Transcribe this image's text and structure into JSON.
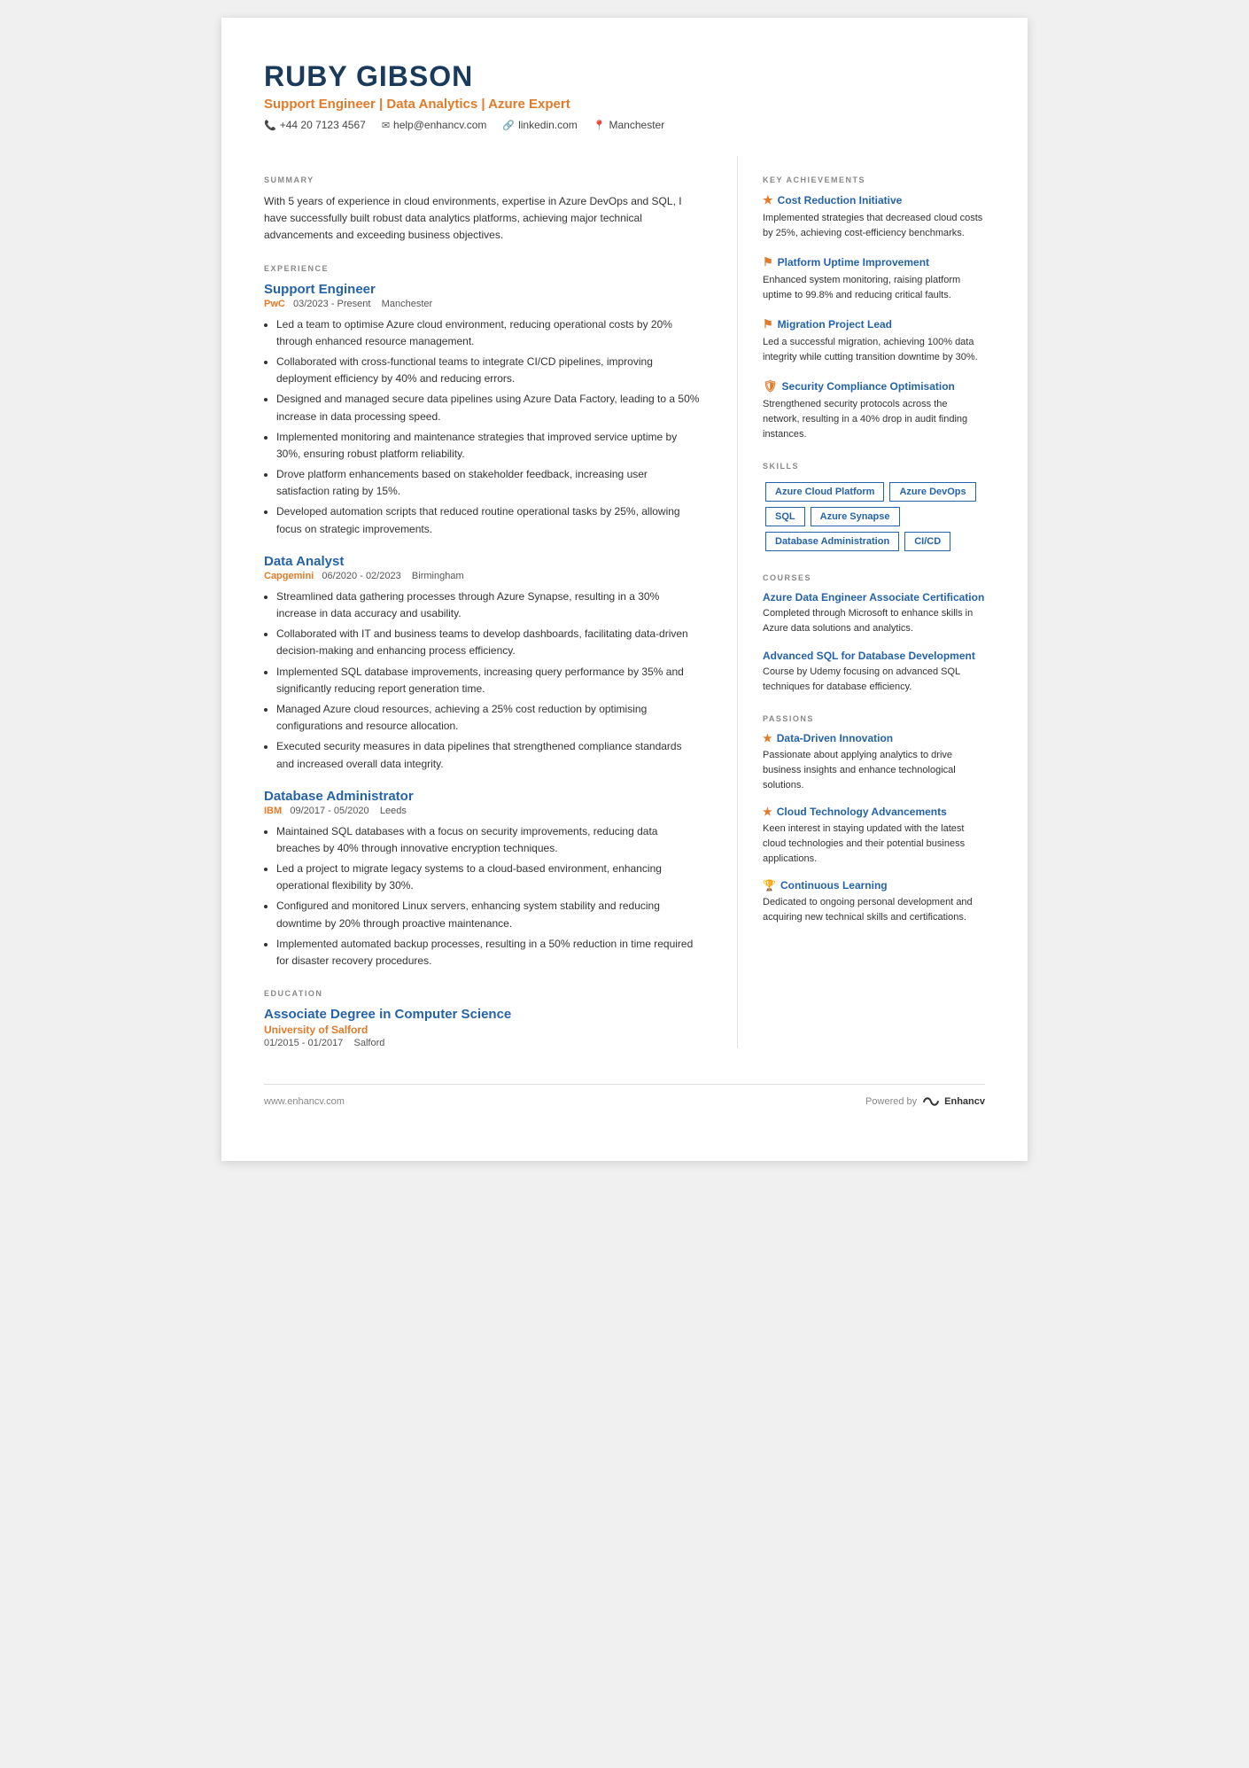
{
  "header": {
    "name": "RUBY GIBSON",
    "title": "Support Engineer | Data Analytics | Azure Expert",
    "phone": "+44 20 7123 4567",
    "email": "help@enhancv.com",
    "linkedin": "linkedin.com",
    "location": "Manchester"
  },
  "summary": {
    "label": "SUMMARY",
    "text": "With 5 years of experience in cloud environments, expertise in Azure DevOps and SQL, I have successfully built robust data analytics platforms, achieving major technical advancements and exceeding business objectives."
  },
  "experience": {
    "label": "EXPERIENCE",
    "jobs": [
      {
        "title": "Support Engineer",
        "company": "PwC",
        "dates": "03/2023 - Present",
        "location": "Manchester",
        "bullets": [
          "Led a team to optimise Azure cloud environment, reducing operational costs by 20% through enhanced resource management.",
          "Collaborated with cross-functional teams to integrate CI/CD pipelines, improving deployment efficiency by 40% and reducing errors.",
          "Designed and managed secure data pipelines using Azure Data Factory, leading to a 50% increase in data processing speed.",
          "Implemented monitoring and maintenance strategies that improved service uptime by 30%, ensuring robust platform reliability.",
          "Drove platform enhancements based on stakeholder feedback, increasing user satisfaction rating by 15%.",
          "Developed automation scripts that reduced routine operational tasks by 25%, allowing focus on strategic improvements."
        ]
      },
      {
        "title": "Data Analyst",
        "company": "Capgemini",
        "dates": "06/2020 - 02/2023",
        "location": "Birmingham",
        "bullets": [
          "Streamlined data gathering processes through Azure Synapse, resulting in a 30% increase in data accuracy and usability.",
          "Collaborated with IT and business teams to develop dashboards, facilitating data-driven decision-making and enhancing process efficiency.",
          "Implemented SQL database improvements, increasing query performance by 35% and significantly reducing report generation time.",
          "Managed Azure cloud resources, achieving a 25% cost reduction by optimising configurations and resource allocation.",
          "Executed security measures in data pipelines that strengthened compliance standards and increased overall data integrity."
        ]
      },
      {
        "title": "Database Administrator",
        "company": "IBM",
        "dates": "09/2017 - 05/2020",
        "location": "Leeds",
        "bullets": [
          "Maintained SQL databases with a focus on security improvements, reducing data breaches by 40% through innovative encryption techniques.",
          "Led a project to migrate legacy systems to a cloud-based environment, enhancing operational flexibility by 30%.",
          "Configured and monitored Linux servers, enhancing system stability and reducing downtime by 20% through proactive maintenance.",
          "Implemented automated backup processes, resulting in a 50% reduction in time required for disaster recovery procedures."
        ]
      }
    ]
  },
  "education": {
    "label": "EDUCATION",
    "items": [
      {
        "degree": "Associate Degree in Computer Science",
        "school": "University of Salford",
        "dates": "01/2015 - 01/2017",
        "location": "Salford"
      }
    ]
  },
  "key_achievements": {
    "label": "KEY ACHIEVEMENTS",
    "items": [
      {
        "icon": "star",
        "title": "Cost Reduction Initiative",
        "text": "Implemented strategies that decreased cloud costs by 25%, achieving cost-efficiency benchmarks."
      },
      {
        "icon": "flag",
        "title": "Platform Uptime Improvement",
        "text": "Enhanced system monitoring, raising platform uptime to 99.8% and reducing critical faults."
      },
      {
        "icon": "flag",
        "title": "Migration Project Lead",
        "text": "Led a successful migration, achieving 100% data integrity while cutting transition downtime by 30%."
      },
      {
        "icon": "shield",
        "title": "Security Compliance Optimisation",
        "text": "Strengthened security protocols across the network, resulting in a 40% drop in audit finding instances."
      }
    ]
  },
  "skills": {
    "label": "SKILLS",
    "items": [
      "Azure Cloud Platform",
      "Azure DevOps",
      "SQL",
      "Azure Synapse",
      "Database Administration",
      "CI/CD"
    ]
  },
  "courses": {
    "label": "COURSES",
    "items": [
      {
        "title": "Azure Data Engineer Associate Certification",
        "text": "Completed through Microsoft to enhance skills in Azure data solutions and analytics."
      },
      {
        "title": "Advanced SQL for Database Development",
        "text": "Course by Udemy focusing on advanced SQL techniques for database efficiency."
      }
    ]
  },
  "passions": {
    "label": "PASSIONS",
    "items": [
      {
        "icon": "star",
        "title": "Data-Driven Innovation",
        "text": "Passionate about applying analytics to drive business insights and enhance technological solutions."
      },
      {
        "icon": "star",
        "title": "Cloud Technology Advancements",
        "text": "Keen interest in staying updated with the latest cloud technologies and their potential business applications."
      },
      {
        "icon": "trophy",
        "title": "Continuous Learning",
        "text": "Dedicated to ongoing personal development and acquiring new technical skills and certifications."
      }
    ]
  },
  "footer": {
    "url": "www.enhancv.com",
    "powered_by": "Powered by",
    "brand": "Enhancv"
  }
}
